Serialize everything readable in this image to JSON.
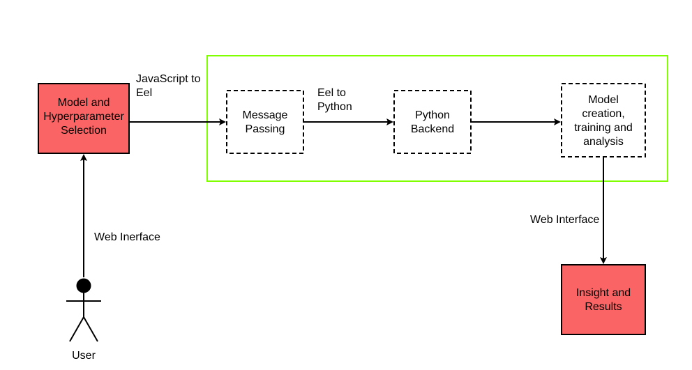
{
  "colors": {
    "accent": "#fa6464",
    "group_border": "#7FFF00"
  },
  "nodes": {
    "model_select": {
      "line1": "Model and",
      "line2": "Hyperparameter",
      "line3": "Selection"
    },
    "message_passing": {
      "line1": "Message",
      "line2": "Passing"
    },
    "python_backend": {
      "line1": "Python",
      "line2": "Backend"
    },
    "model_creation": {
      "line1": "Model",
      "line2": "creation,",
      "line3": "training and",
      "line4": "analysis"
    },
    "insight": {
      "line1": "Insight and",
      "line2": "Results"
    }
  },
  "edges": {
    "js_to_eel": {
      "line1": "JavaScript to",
      "line2": "Eel"
    },
    "eel_to_python": {
      "line1": "Eel to",
      "line2": "Python"
    },
    "web_interface_out": "Web Interface",
    "web_interface_in": "Web Inerface"
  },
  "actors": {
    "user": "User"
  }
}
